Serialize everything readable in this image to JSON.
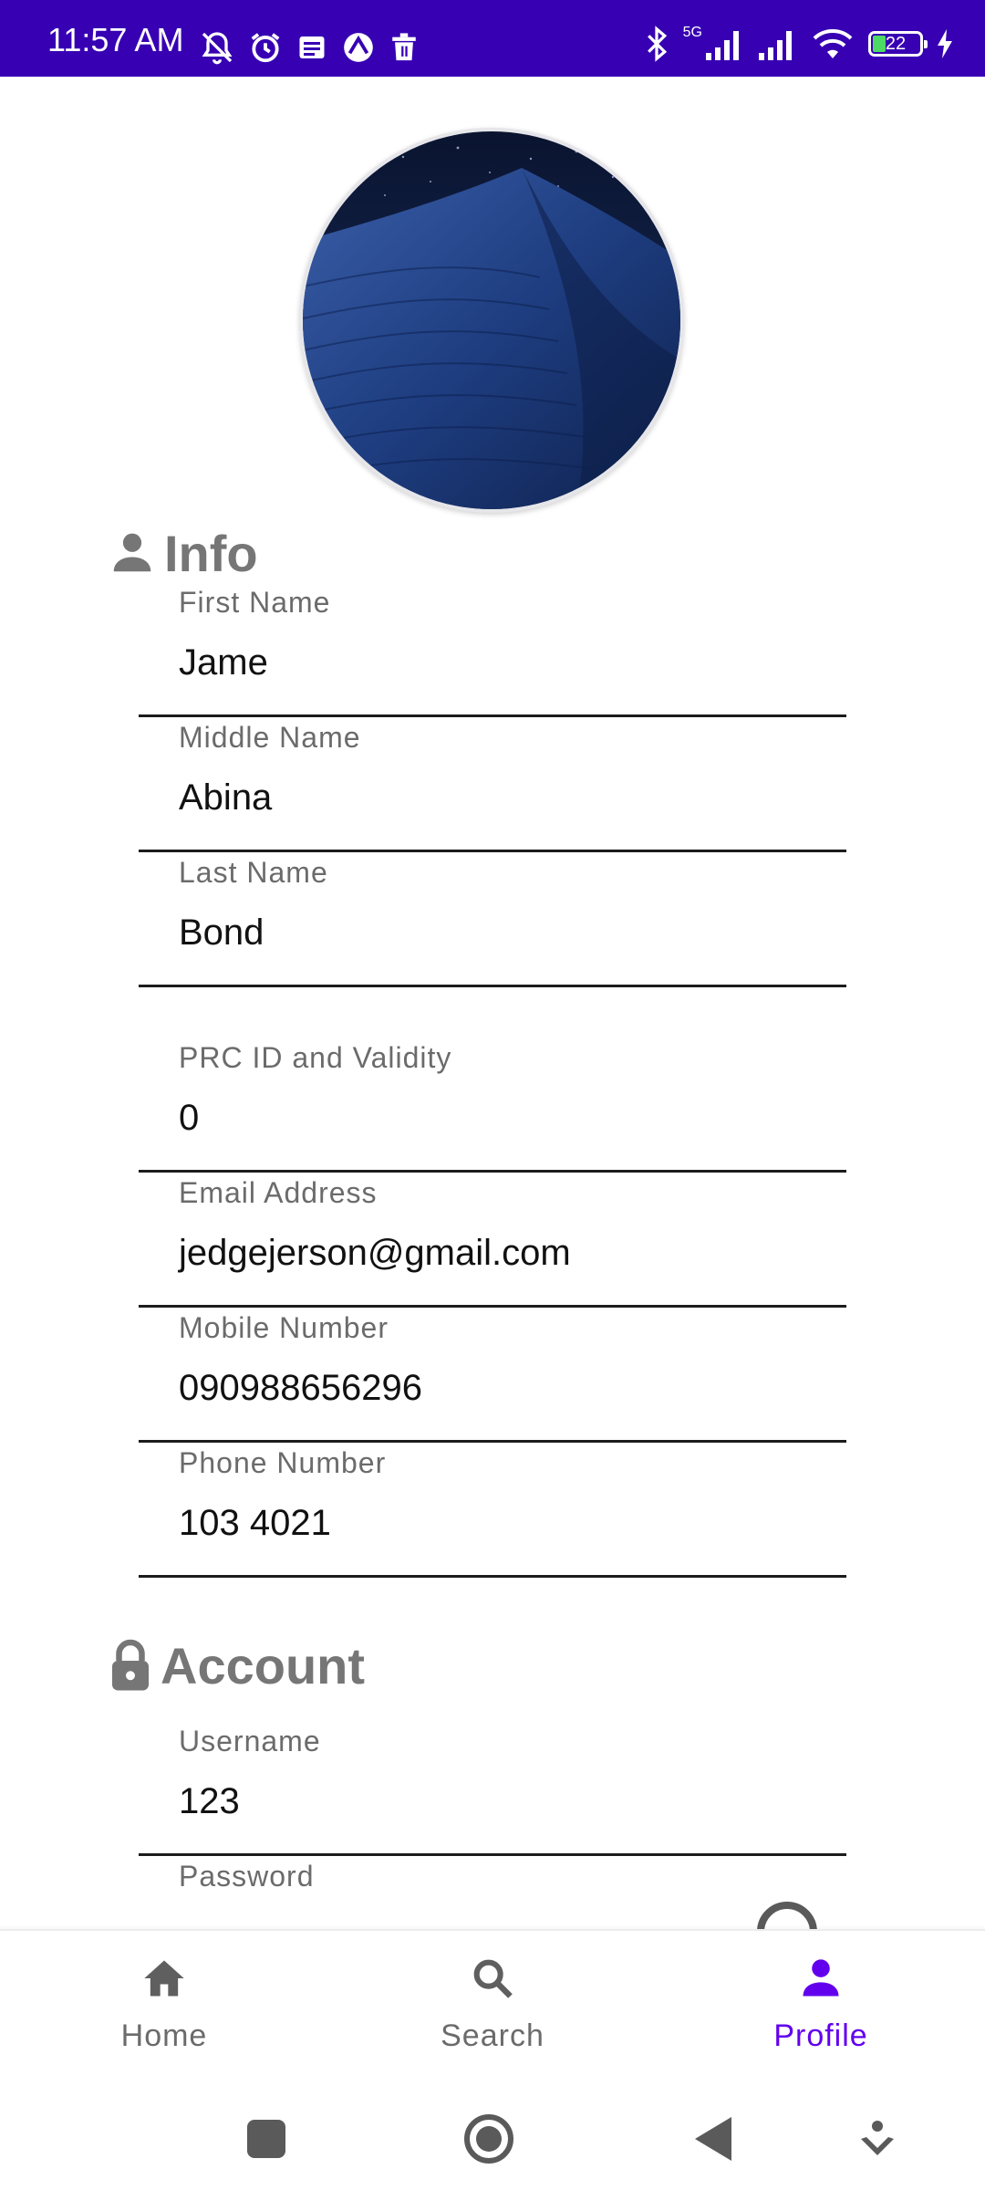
{
  "status_bar": {
    "time": "11:57 AM",
    "network_label": "5G",
    "battery_level": "22",
    "background_color": "#3700b3",
    "icons_left": [
      "alarm-off-icon",
      "alarm-clock-icon",
      "message-icon",
      "vpn-icon",
      "trash-icon"
    ],
    "icons_right": [
      "bluetooth-icon",
      "signal-icon",
      "signal-icon",
      "wifi-icon",
      "battery-icon",
      "charging-icon"
    ]
  },
  "profile": {
    "avatar": "desert-dune-night-image"
  },
  "info_section": {
    "title": "Info",
    "icon": "person-icon",
    "fields": {
      "first_name": {
        "label": "First Name",
        "value": "Jame"
      },
      "middle_name": {
        "label": "Middle Name",
        "value": "Abina"
      },
      "last_name": {
        "label": "Last Name",
        "value": "Bond"
      },
      "prc_id": {
        "label": "PRC ID and Validity",
        "value": "0"
      },
      "email": {
        "label": "Email Address",
        "value": "jedgejerson@gmail.com"
      },
      "mobile": {
        "label": "Mobile Number",
        "value": "090988656296"
      },
      "phone": {
        "label": "Phone Number",
        "value": "103 4021"
      }
    }
  },
  "account_section": {
    "title": "Account",
    "icon": "lock-icon",
    "fields": {
      "username": {
        "label": "Username",
        "value": "123"
      },
      "password": {
        "label": "Password",
        "value": ""
      }
    }
  },
  "bottom_nav": {
    "items": [
      {
        "label": "Home",
        "icon": "home-icon",
        "active": false
      },
      {
        "label": "Search",
        "icon": "search-icon",
        "active": false
      },
      {
        "label": "Profile",
        "icon": "person-icon",
        "active": true
      }
    ],
    "active_color": "#6200ee",
    "inactive_color": "#6b6b6b"
  },
  "system_nav": {
    "buttons": [
      "recents-icon",
      "home-circle-icon",
      "back-icon",
      "menu-down-icon"
    ]
  }
}
